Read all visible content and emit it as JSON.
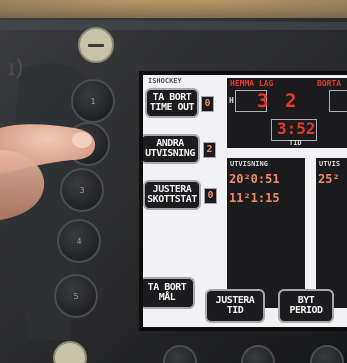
{
  "screen": {
    "title": "ISHOCKEY",
    "colors": {
      "digit_red": "#e4392a",
      "digit_orange": "#f08a6a",
      "lcd_background": "#f2f2f4",
      "panel_dark": "#1b1b1d"
    },
    "left_buttons": [
      {
        "line1": "TA BORT",
        "line2": "TIME OUT",
        "count": "0"
      },
      {
        "line1": "ANDRA",
        "line2": "UTVISNING",
        "count": "2"
      },
      {
        "line1": "JUSTERA",
        "line2": "SKOTTSTAT",
        "count": "0"
      }
    ],
    "home": {
      "label": "HEMMA LAG",
      "marker": "H",
      "score": "3",
      "period": "2"
    },
    "away": {
      "label": "BORTA"
    },
    "clock": {
      "value": "3:52",
      "label": "TID"
    },
    "penalties_home": {
      "label": "UTVISNING",
      "rows": [
        "20²0:51",
        "11²1:15"
      ]
    },
    "penalties_away": {
      "label": "UTVIS",
      "rows": [
        "25²"
      ]
    },
    "bottom_buttons": [
      {
        "line1": "TA BORT",
        "line2": "MÅL"
      },
      {
        "line1": "JUSTERA",
        "line2": "TID"
      },
      {
        "line1": "BYT",
        "line2": "PERIOD"
      }
    ]
  },
  "bezel": {
    "key_icons": [
      "1-icon",
      "2-icon",
      "3-icon",
      "4-icon",
      "5-icon"
    ]
  }
}
